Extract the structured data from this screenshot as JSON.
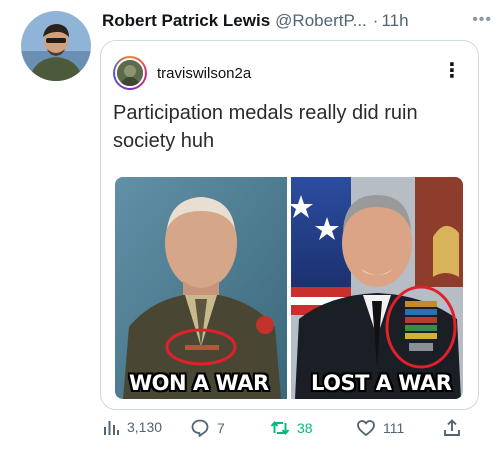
{
  "tweet": {
    "display_name": "Robert Patrick Lewis",
    "handle": "@RobertP...",
    "separator": "·",
    "time": "11h",
    "more_icon": "more-horizontal-icon"
  },
  "embedded_post": {
    "username": "traviswilson2a",
    "caption": "Participation medals really did ruin society huh",
    "menu_icon": "kebab-menu-icon",
    "meme": {
      "left_label": "WON A WAR",
      "right_label": "LOST A WAR"
    }
  },
  "actions": {
    "views": "3,130",
    "replies": "7",
    "retweets": "38",
    "likes": "111"
  },
  "colors": {
    "text_primary": "#0f1419",
    "text_secondary": "#536471",
    "retweet_green": "#00ba7c",
    "border": "#cfd9de",
    "highlight_red": "#e0202a"
  }
}
